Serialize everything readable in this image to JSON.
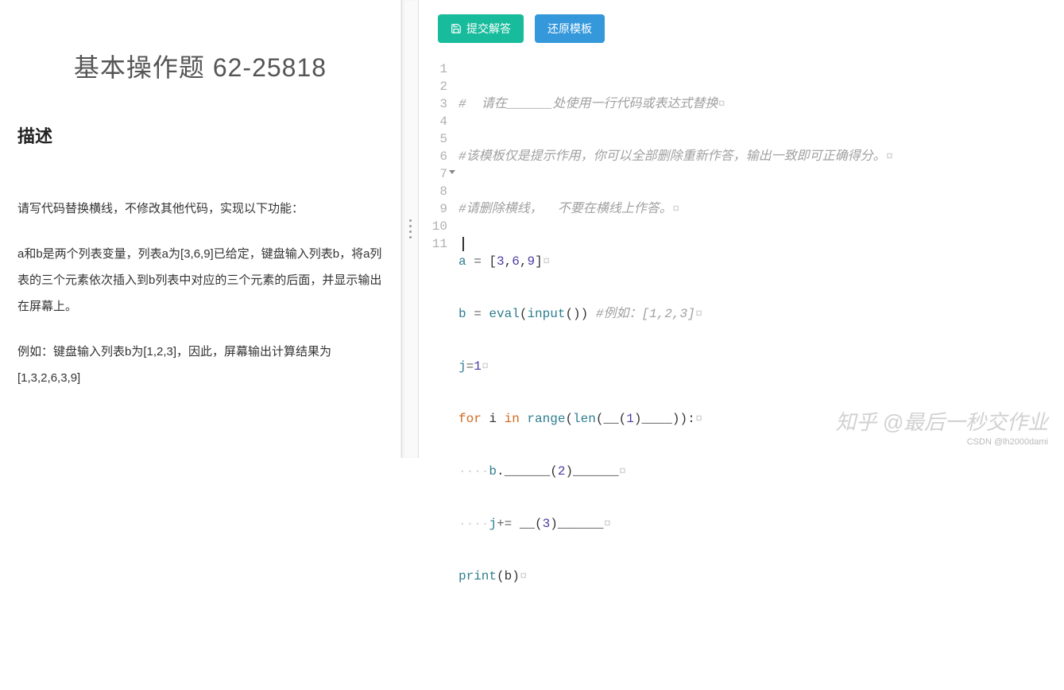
{
  "problem": {
    "title": "基本操作题 62-25818",
    "description_heading": "描述",
    "paragraph1": "请写代码替换横线，不修改其他代码，实现以下功能：",
    "paragraph2": "a和b是两个列表变量，列表a为[3,6,9]已给定，键盘输入列表b，将a列表的三个元素依次插入到b列表中对应的三个元素的后面，并显示输出在屏幕上。",
    "paragraph3": "例如：键盘输入列表b为[1,2,3]，因此，屏幕输出计算结果为[1,3,2,6,3,9]"
  },
  "toolbar": {
    "submit_label": "提交解答",
    "reset_label": "还原模板"
  },
  "code_lines": {
    "l1": "#  请在______处使用一行代码或表达式替换",
    "l2": "#该模板仅是提示作用，你可以全部删除重新作答，输出一致即可正确得分。",
    "l3": "#请删除横线，  不要在横线上作答。",
    "l4_a": "a",
    "l4_eq": " = ",
    "l4_br1": "[",
    "l4_n1": "3",
    "l4_c1": ",",
    "l4_n2": "6",
    "l4_c2": ",",
    "l4_n3": "9",
    "l4_br2": "]",
    "l5_a": "b",
    "l5_eq": " = ",
    "l5_eval": "eval",
    "l5_p1": "(",
    "l5_input": "input",
    "l5_p2": "())",
    "l5_comment": " #例如：[1,2,3]",
    "l6_j": "j",
    "l6_eq": "=",
    "l6_v": "1",
    "l7_for": "for",
    "l7_i": " i ",
    "l7_in": "in",
    "l7_range": " range",
    "l7_p1": "(",
    "l7_len": "len",
    "l7_p2": "(__(",
    "l7_n": "1",
    "l7_p3": ")____)):",
    "l8_b": "b",
    "l8_rest": ".______(",
    "l8_n": "2",
    "l8_tail": ")______",
    "l9_j": "j",
    "l9_op": "+=",
    "l9_rest": " __(",
    "l9_n": "3",
    "l9_tail": ")______",
    "l10_print": "print",
    "l10_p": "(b)"
  },
  "line_numbers": [
    "1",
    "2",
    "3",
    "4",
    "5",
    "6",
    "7",
    "8",
    "9",
    "10",
    "11"
  ],
  "watermark": {
    "main": "知乎 @最后一秒交作业",
    "sub": "CSDN @lh2000dami"
  }
}
